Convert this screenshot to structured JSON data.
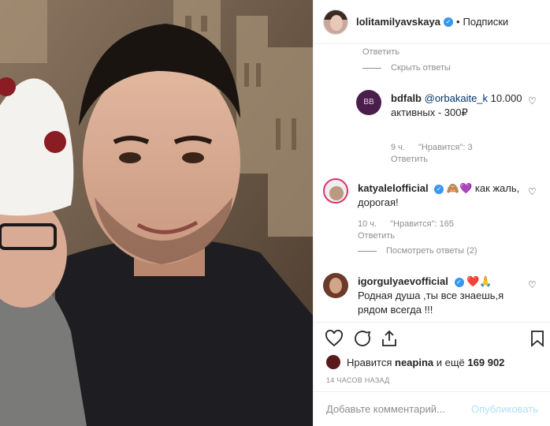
{
  "header": {
    "username": "lolitamilyavskaya",
    "separator": "•",
    "follow_label": "Подписки"
  },
  "comments": {
    "reply_link_top": "Ответить",
    "hide_replies": "Скрыть ответы",
    "reply1": {
      "avatar_text": "BB",
      "username": "bdfalb",
      "mention": "@orbakaite_k",
      "text": "10.000 активных - 300₽",
      "time": "9 ч.",
      "likes": "\"Нравится\": 3",
      "reply": "Ответить"
    },
    "comment2": {
      "username": "katyalelofficial",
      "emoji": "🙈💜",
      "text": "как жаль, дорогая!",
      "time": "10 ч.",
      "likes": "\"Нравится\": 165",
      "reply": "Ответить",
      "view_replies": "Посмотреть ответы (2)"
    },
    "comment3": {
      "username": "igorgulyaevofficial",
      "emoji": "❤️🙏",
      "text": "Родная душа ,ты все знаешь,я рядом всегда !!!"
    }
  },
  "likes": {
    "prefix": "Нравится",
    "user": "neapina",
    "suffix": "и ещё",
    "count": "169 902"
  },
  "timestamp": "14 часов назад",
  "add_comment": {
    "placeholder": "Добавьте комментарий...",
    "publish": "Опубликовать"
  },
  "colors": {
    "accent": "#3897f0",
    "muted": "#8e8e8e",
    "publish_disabled": "#b2dffc"
  }
}
